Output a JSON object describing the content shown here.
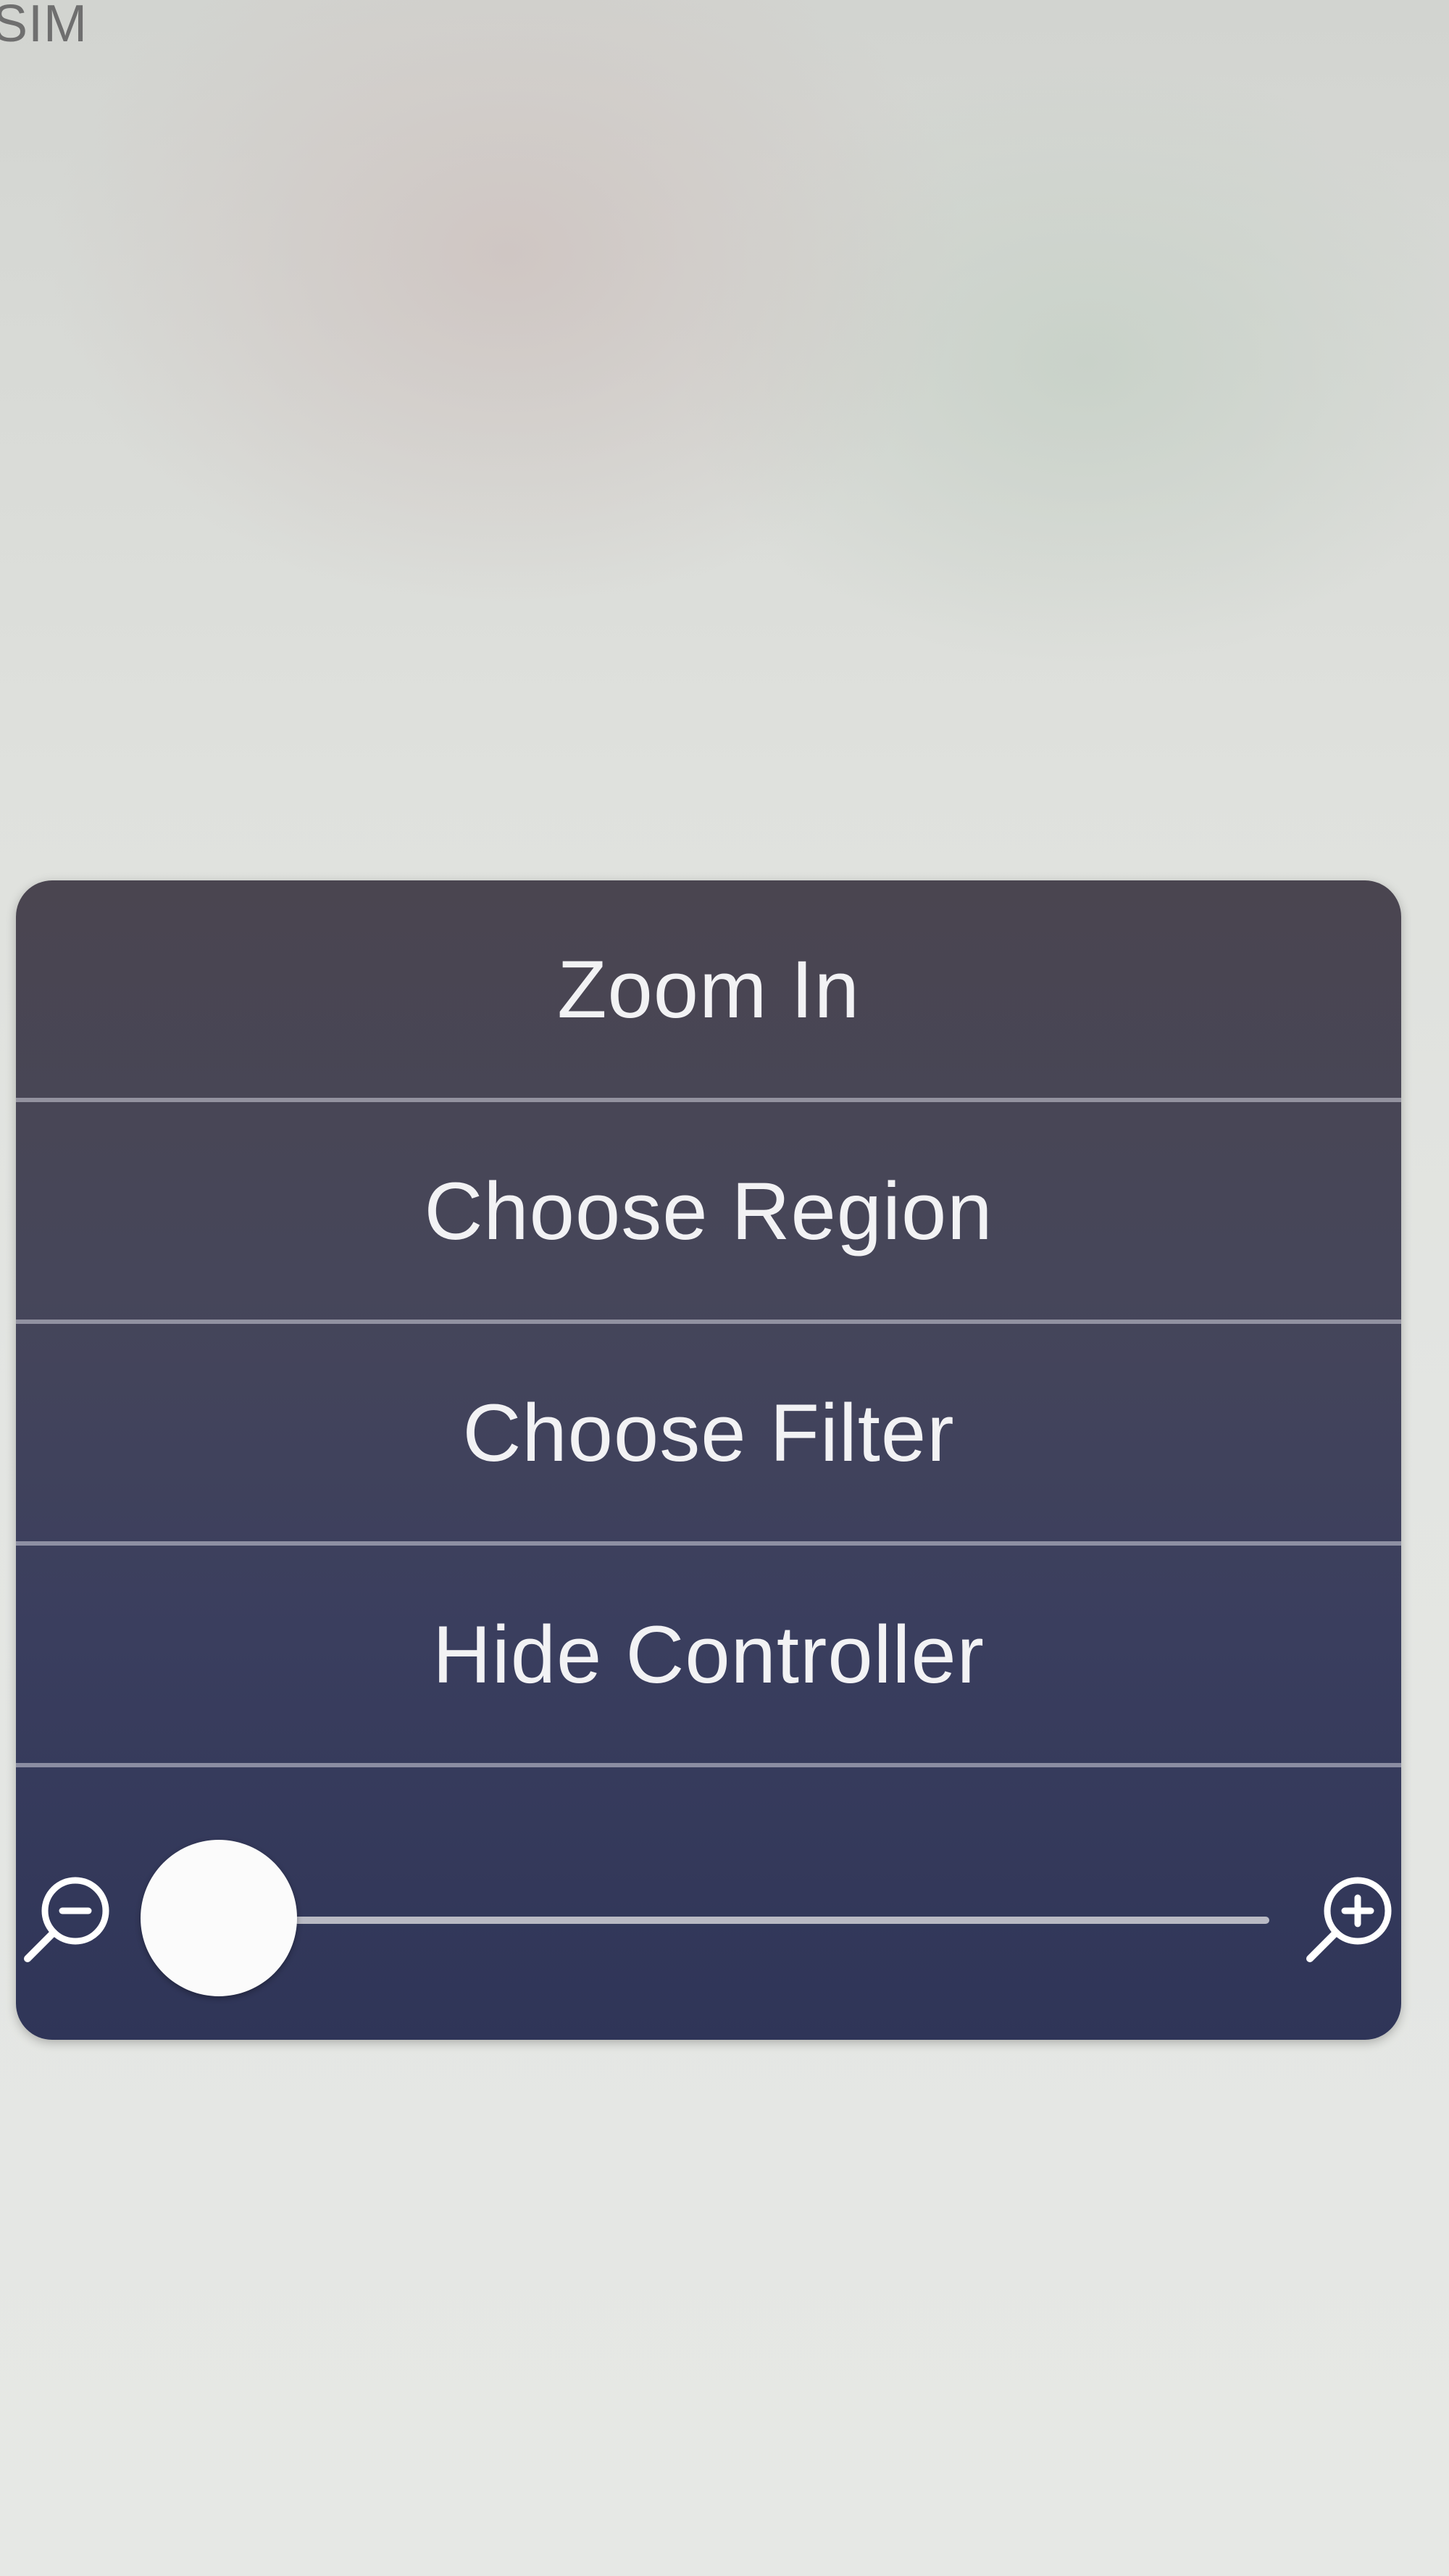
{
  "status_bar": {
    "carrier": "SIM"
  },
  "menu": {
    "items": [
      {
        "label": "Zoom In",
        "icon": ""
      },
      {
        "label": "Choose Region",
        "icon": ""
      },
      {
        "label": "Choose Filter",
        "icon": ""
      },
      {
        "label": "Hide Controller",
        "icon": ""
      }
    ]
  },
  "zoom_slider": {
    "level": 0.02,
    "min_icon": "magnifier-minus-icon",
    "max_icon": "magnifier-plus-icon"
  },
  "colors": {
    "panel": "#3f4058",
    "text": "#f2f2f4",
    "separator": "#c8c8d2"
  }
}
